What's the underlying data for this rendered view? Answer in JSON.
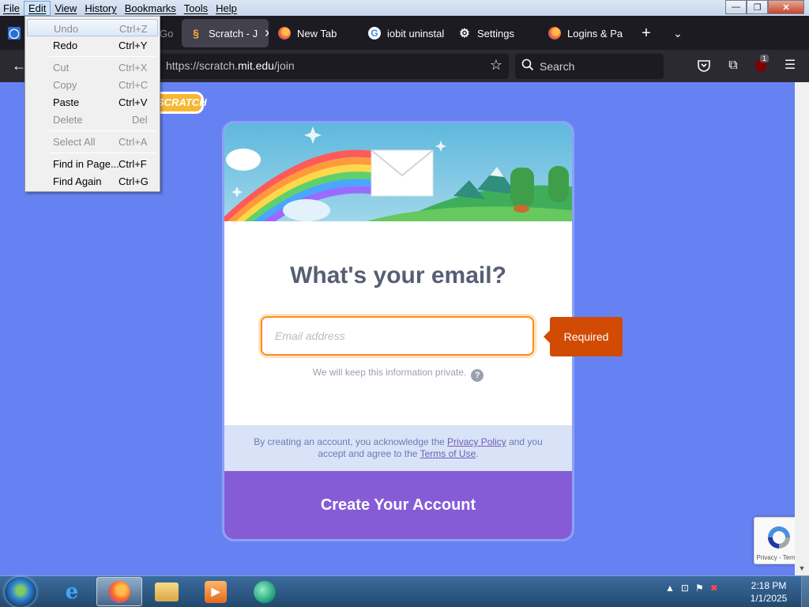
{
  "menubar": {
    "items": [
      "File",
      "Edit",
      "View",
      "History",
      "Bookmarks",
      "Tools",
      "Help"
    ]
  },
  "window_controls": {
    "minimize": "—",
    "maximize": "❐",
    "close": "✕"
  },
  "tabs": [
    {
      "label": "Go",
      "icon": "go-tab-icon"
    },
    {
      "label": "Scratch - J",
      "icon": "scratch-icon",
      "active": true
    },
    {
      "label": "New Tab",
      "icon": "firefox-icon"
    },
    {
      "label": "iobit uninstal",
      "icon": "google-icon"
    },
    {
      "label": "Settings",
      "icon": "gear-icon"
    },
    {
      "label": "Logins & Pa",
      "icon": "firefox-icon"
    }
  ],
  "navbar": {
    "url_prefix": "https://scratch.",
    "url_domain": "mit.edu",
    "url_path": "/join",
    "search_placeholder": "Search",
    "extension_badge": "1"
  },
  "edit_menu": {
    "items": [
      {
        "label": "Undo",
        "shortcut": "Ctrl+Z",
        "disabled": true,
        "highlighted": true
      },
      {
        "label": "Redo",
        "shortcut": "Ctrl+Y"
      },
      {
        "label": "Cut",
        "shortcut": "Ctrl+X",
        "disabled": true
      },
      {
        "label": "Copy",
        "shortcut": "Ctrl+C",
        "disabled": true
      },
      {
        "label": "Paste",
        "shortcut": "Ctrl+V"
      },
      {
        "label": "Delete",
        "shortcut": "Del",
        "disabled": true
      },
      {
        "label": "Select All",
        "shortcut": "Ctrl+A",
        "disabled": true
      },
      {
        "label": "Find in Page...",
        "shortcut": "Ctrl+F"
      },
      {
        "label": "Find Again",
        "shortcut": "Ctrl+G"
      }
    ]
  },
  "page": {
    "logo_text": "SCRATCH",
    "title": "What's your email?",
    "email_placeholder": "Email address",
    "privacy_note": "We will keep this information private.",
    "help_glyph": "?",
    "required_tooltip": "Required",
    "legal_part1": "By creating an account, you acknowledge the ",
    "privacy_link": "Privacy Policy",
    "legal_part2": " and you accept and agree to the ",
    "terms_link": "Terms of Use",
    "legal_part3": ".",
    "create_button": "Create Your Account",
    "recaptcha_text": "Privacy - Terms"
  },
  "taskbar": {
    "time": "2:18 PM",
    "date": "1/1/2025"
  },
  "colors": {
    "page_bg": "#6682f2",
    "create_button": "#855cd6",
    "required_tooltip": "#d14b05",
    "input_focus": "#ff8c1a"
  }
}
